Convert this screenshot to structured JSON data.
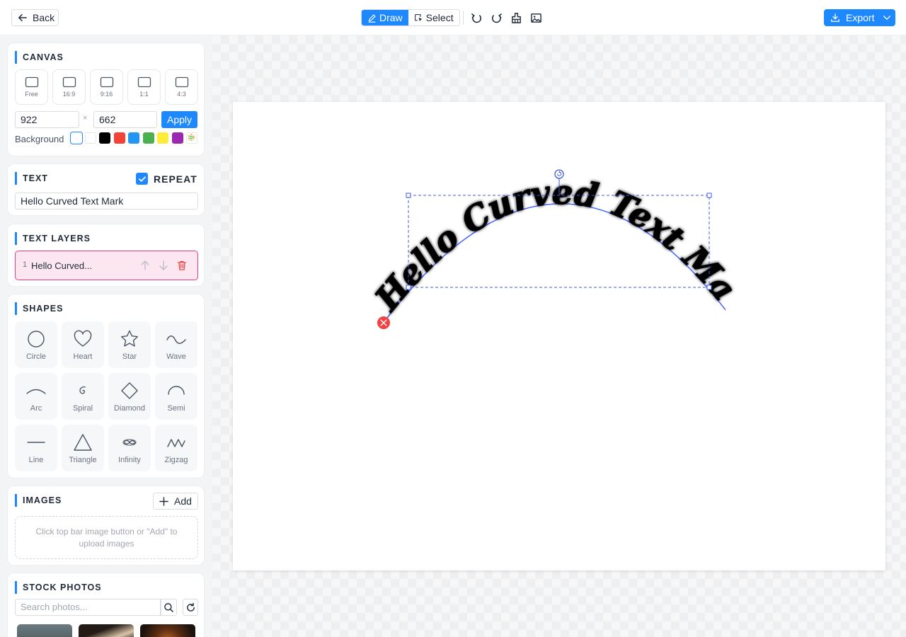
{
  "topbar": {
    "back_label": "Back",
    "modes": [
      {
        "label": "Draw",
        "icon": "pencil-icon",
        "active": true
      },
      {
        "label": "Select",
        "icon": "select-cursor-icon",
        "active": false
      }
    ],
    "tools": [
      "undo-icon",
      "redo-icon",
      "clear-icon",
      "image-icon"
    ],
    "export_label": "Export"
  },
  "canvas_panel": {
    "title": "CANVAS",
    "ratios": [
      "Free",
      "16:9",
      "9:16",
      "1:1",
      "4:3"
    ],
    "width": "922",
    "height": "662",
    "x_sep": "×",
    "apply_label": "Apply",
    "background_label": "Background",
    "swatches": [
      "#ffffff",
      "#ffffff",
      "#000000",
      "#f44336",
      "#2196f3",
      "#4caf50",
      "#ffeb3b",
      "#9c27b0",
      "custom"
    ]
  },
  "text_panel": {
    "title": "TEXT",
    "repeat_label": "REPEAT",
    "repeat_checked": true,
    "value": "Hello Curved Text Mark"
  },
  "layers_panel": {
    "title": "TEXT LAYERS",
    "layers": [
      {
        "index": "1",
        "name": "Hello Curved..."
      }
    ]
  },
  "shapes_panel": {
    "title": "SHAPES",
    "shapes": [
      "Circle",
      "Heart",
      "Star",
      "Wave",
      "Arc",
      "Spiral",
      "Diamond",
      "Semi",
      "Line",
      "Triangle",
      "Infinity",
      "Zigzag"
    ]
  },
  "images_panel": {
    "title": "IMAGES",
    "add_label": "Add",
    "hint": "Click top bar image button or \"Add\" to upload images"
  },
  "stock_panel": {
    "title": "STOCK PHOTOS",
    "search_placeholder": "Search photos..."
  },
  "canvas_text": {
    "content": "Hello Curved Text Mark",
    "color": "#000000",
    "path_color": "#4f6cff"
  }
}
